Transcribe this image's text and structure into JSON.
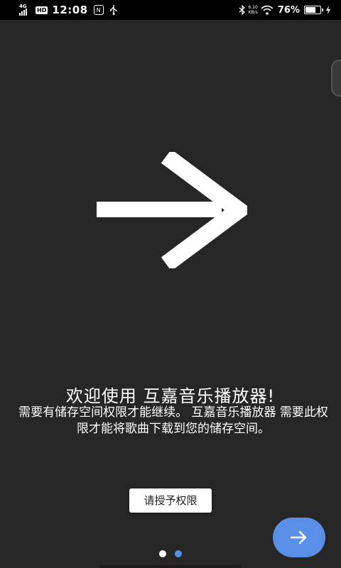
{
  "status_bar": {
    "network_type": "4G",
    "hd_label": "HD",
    "time": "12:08",
    "app_badge": "N",
    "net_speed_value": "6.10",
    "net_speed_unit": "KB/s",
    "battery_percent": "76%",
    "battery_level": 0.76
  },
  "main": {
    "title": "欢迎使用 互嘉音乐播放器!",
    "description": "需要有储存空间权限才能继续。 互嘉音乐播放器 需要此权限才能将歌曲下载到您的储存空间。",
    "grant_button_label": "请授予权限"
  },
  "pagination": {
    "total": 2,
    "active_index": 0
  },
  "colors": {
    "background": "#262626",
    "accent": "#5a8fe8",
    "text": "#ffffff"
  },
  "icons": {
    "hero": "arrow-right-icon",
    "fab": "arrow-right-icon"
  }
}
